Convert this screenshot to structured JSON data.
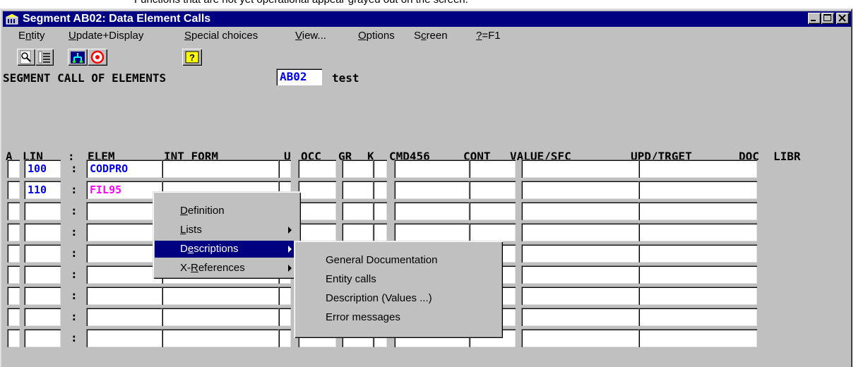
{
  "caption": "Functions that are not yet operational appear grayed out on the screen.",
  "window": {
    "title": "Segment AB02: Data Element Calls",
    "controls": [
      "minimize",
      "maximize",
      "close"
    ]
  },
  "menubar": {
    "items": [
      {
        "label": "Entity",
        "key": "n"
      },
      {
        "label": "Update+Display",
        "key": "U"
      },
      {
        "label": "Special choices",
        "key": "S"
      },
      {
        "label": "View...",
        "key": "V"
      },
      {
        "label": "Options",
        "key": "O"
      },
      {
        "label": "Screen",
        "key": "c"
      },
      {
        "label": "?=F1",
        "key": "?"
      }
    ]
  },
  "toolbar": {
    "icons": [
      "search-document-icon",
      "numbered-list-icon",
      "tree-chart-icon",
      "target-icon",
      "help-icon"
    ]
  },
  "segment": {
    "line": "SEGMENT CALL OF ELEMENTS",
    "code": "AB02",
    "label": "test"
  },
  "grid": {
    "headers": {
      "a": "A",
      "lin": "LIN",
      "sep": ":",
      "elem": "ELEM",
      "int_form": "INT FORM",
      "u": "U",
      "occ": "OCC",
      "gr": "GR",
      "k": "K",
      "cmd456": "CMD456",
      "cont": "CONT",
      "value_sfc": "VALUE/SFC",
      "upd_trget": "UPD/TRGET",
      "doc": "DOC",
      "libr": "LIBR"
    },
    "rows": [
      {
        "lin": "100",
        "elem": "CODPRO"
      },
      {
        "lin": "110",
        "elem": "FIL95"
      },
      {
        "lin": "",
        "elem": ""
      },
      {
        "lin": "",
        "elem": ""
      },
      {
        "lin": "",
        "elem": ""
      },
      {
        "lin": "",
        "elem": ""
      },
      {
        "lin": "",
        "elem": ""
      },
      {
        "lin": "",
        "elem": ""
      },
      {
        "lin": "",
        "elem": ""
      }
    ],
    "colors": {
      "lin": "#0000ee",
      "elem_row1": "#0000ee",
      "elem_row2": "#ff00ff"
    }
  },
  "context_menu": {
    "items": [
      "Definition",
      "Lists",
      "Descriptions",
      "X-References"
    ],
    "selected": "Descriptions"
  },
  "submenu": {
    "items": [
      "General Documentation",
      "Entity calls",
      "Description (Values ...)",
      "Error messages"
    ]
  }
}
